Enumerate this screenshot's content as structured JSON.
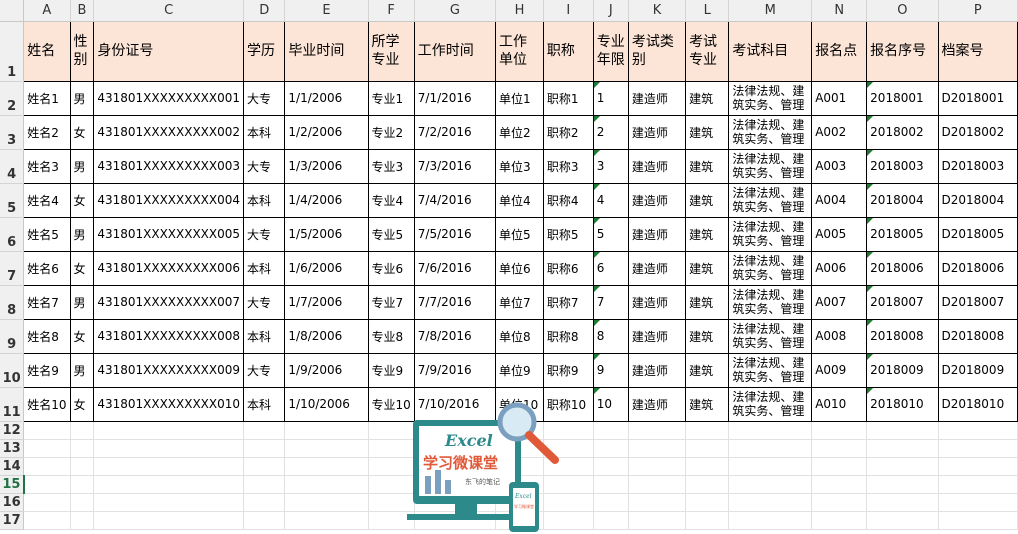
{
  "columns": [
    "A",
    "B",
    "C",
    "D",
    "E",
    "F",
    "G",
    "H",
    "I",
    "J",
    "K",
    "L",
    "M",
    "N",
    "O",
    "P"
  ],
  "headers": [
    "姓名",
    "性别",
    "身份证号",
    "学历",
    "毕业时间",
    "所学专业",
    "工作时间",
    "工作单位",
    "职称",
    "专业年限",
    "考试类别",
    "考试专业",
    "考试科目",
    "报名点",
    "报名序号",
    "档案号"
  ],
  "rows": [
    [
      "姓名1",
      "男",
      "431801XXXXXXXXX001",
      "大专",
      "1/1/2006",
      "专业1",
      "7/1/2016",
      "单位1",
      "职称1",
      "1",
      "建造师",
      "建筑",
      "法律法规、建筑实务、管理",
      "A001",
      "2018001",
      "D2018001"
    ],
    [
      "姓名2",
      "女",
      "431801XXXXXXXXX002",
      "本科",
      "1/2/2006",
      "专业2",
      "7/2/2016",
      "单位2",
      "职称2",
      "2",
      "建造师",
      "建筑",
      "法律法规、建筑实务、管理",
      "A002",
      "2018002",
      "D2018002"
    ],
    [
      "姓名3",
      "男",
      "431801XXXXXXXXX003",
      "大专",
      "1/3/2006",
      "专业3",
      "7/3/2016",
      "单位3",
      "职称3",
      "3",
      "建造师",
      "建筑",
      "法律法规、建筑实务、管理",
      "A003",
      "2018003",
      "D2018003"
    ],
    [
      "姓名4",
      "女",
      "431801XXXXXXXXX004",
      "本科",
      "1/4/2006",
      "专业4",
      "7/4/2016",
      "单位4",
      "职称4",
      "4",
      "建造师",
      "建筑",
      "法律法规、建筑实务、管理",
      "A004",
      "2018004",
      "D2018004"
    ],
    [
      "姓名5",
      "男",
      "431801XXXXXXXXX005",
      "大专",
      "1/5/2006",
      "专业5",
      "7/5/2016",
      "单位5",
      "职称5",
      "5",
      "建造师",
      "建筑",
      "法律法规、建筑实务、管理",
      "A005",
      "2018005",
      "D2018005"
    ],
    [
      "姓名6",
      "女",
      "431801XXXXXXXXX006",
      "本科",
      "1/6/2006",
      "专业6",
      "7/6/2016",
      "单位6",
      "职称6",
      "6",
      "建造师",
      "建筑",
      "法律法规、建筑实务、管理",
      "A006",
      "2018006",
      "D2018006"
    ],
    [
      "姓名7",
      "男",
      "431801XXXXXXXXX007",
      "大专",
      "1/7/2006",
      "专业7",
      "7/7/2016",
      "单位7",
      "职称7",
      "7",
      "建造师",
      "建筑",
      "法律法规、建筑实务、管理",
      "A007",
      "2018007",
      "D2018007"
    ],
    [
      "姓名8",
      "女",
      "431801XXXXXXXXX008",
      "本科",
      "1/8/2006",
      "专业8",
      "7/8/2016",
      "单位8",
      "职称8",
      "8",
      "建造师",
      "建筑",
      "法律法规、建筑实务、管理",
      "A008",
      "2018008",
      "D2018008"
    ],
    [
      "姓名9",
      "男",
      "431801XXXXXXXXX009",
      "大专",
      "1/9/2006",
      "专业9",
      "7/9/2016",
      "单位9",
      "职称9",
      "9",
      "建造师",
      "建筑",
      "法律法规、建筑实务、管理",
      "A009",
      "2018009",
      "D2018009"
    ],
    [
      "姓名10",
      "女",
      "431801XXXXXXXXX010",
      "本科",
      "1/10/2006",
      "专业10",
      "7/10/2016",
      "单位10",
      "职称10",
      "10",
      "建造师",
      "建筑",
      "法律法规、建筑实务、管理",
      "A010",
      "2018010",
      "D2018010"
    ]
  ],
  "row_numbers": [
    "1",
    "2",
    "3",
    "4",
    "5",
    "6",
    "7",
    "8",
    "9",
    "10",
    "11",
    "12",
    "13",
    "14",
    "15",
    "16",
    "17"
  ],
  "active_row": "15",
  "logo": {
    "title": "Excel",
    "subtitle": "学习微课堂",
    "tagline": "东飞的笔记",
    "phone_title": "Excel",
    "phone_subtitle": "学习微课堂",
    "colors": {
      "accent": "#e05a3a",
      "frame": "#2d8a8a",
      "screen": "#7a9fbf",
      "glass": "#d8eaf4"
    }
  },
  "colors": {
    "header_fill": "#fce4d6",
    "grid": "#e1e1e1",
    "border": "#000000",
    "select": "#217346",
    "note_marker": "#1e7b34"
  }
}
